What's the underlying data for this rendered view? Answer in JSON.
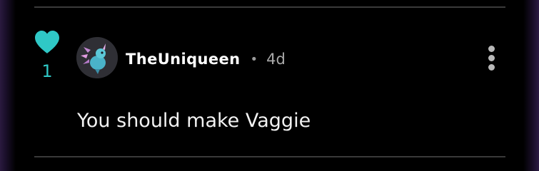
{
  "comment": {
    "likes": {
      "count": "1",
      "icon": "heart-icon",
      "color": "#2fc8c6"
    },
    "author": {
      "username": "TheUniqueen",
      "avatar": "dragon-avatar"
    },
    "separator": "•",
    "timestamp": "4d",
    "text": "You should make Vaggie",
    "more_icon": "more-vertical-icon"
  },
  "colors": {
    "background": "#000000",
    "accent": "#2fc8c6",
    "divider": "#3a3a3a",
    "text": "#f2f2f2",
    "meta": "#a9a9a9"
  }
}
